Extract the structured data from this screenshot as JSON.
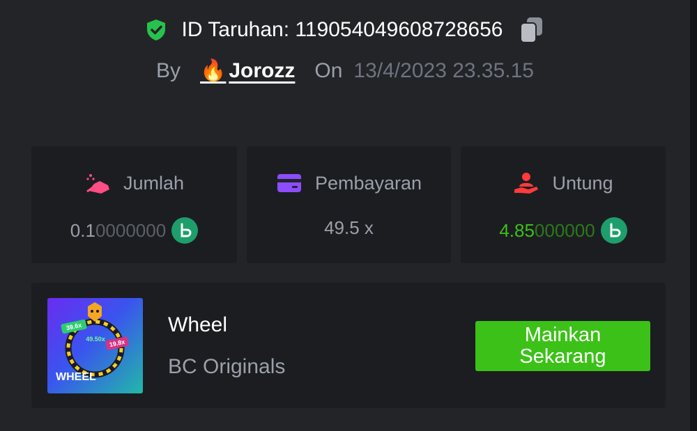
{
  "bet": {
    "id_label": "ID Taruhan:",
    "id_value": "119054049608728656",
    "by_label": "By",
    "user_emoji": "🔥",
    "username": "Jorozz",
    "on_label": "On",
    "date": "13/4/2023 23.35.15"
  },
  "stats": {
    "amount": {
      "label": "Jumlah",
      "value_bright": "0.1",
      "value_dim": "0000000"
    },
    "payout": {
      "label": "Pembayaran",
      "value": "49.5 x"
    },
    "profit": {
      "label": "Untung",
      "value_bright": "4.85",
      "value_dim": "000000"
    }
  },
  "game": {
    "name": "Wheel",
    "provider": "BC Originals",
    "play_label": "Mainkan\nSekarang",
    "thumb_text": "WHEEL",
    "thumb_labels": [
      "39.6x",
      "49.50x",
      "19.8x"
    ]
  },
  "colors": {
    "background": "#232428",
    "card": "#1c1d21",
    "accent_green": "#3bc117",
    "profit_green": "#3bc117",
    "coin": "#1e9e6b",
    "muted": "#9aa0aa"
  },
  "icons": {
    "verified": "shield-check-icon",
    "copy": "copy-icon",
    "amount": "hand-coins-icon",
    "payout": "wallet-card-icon",
    "profit": "hand-user-icon",
    "currency": "bc-coin-icon"
  }
}
